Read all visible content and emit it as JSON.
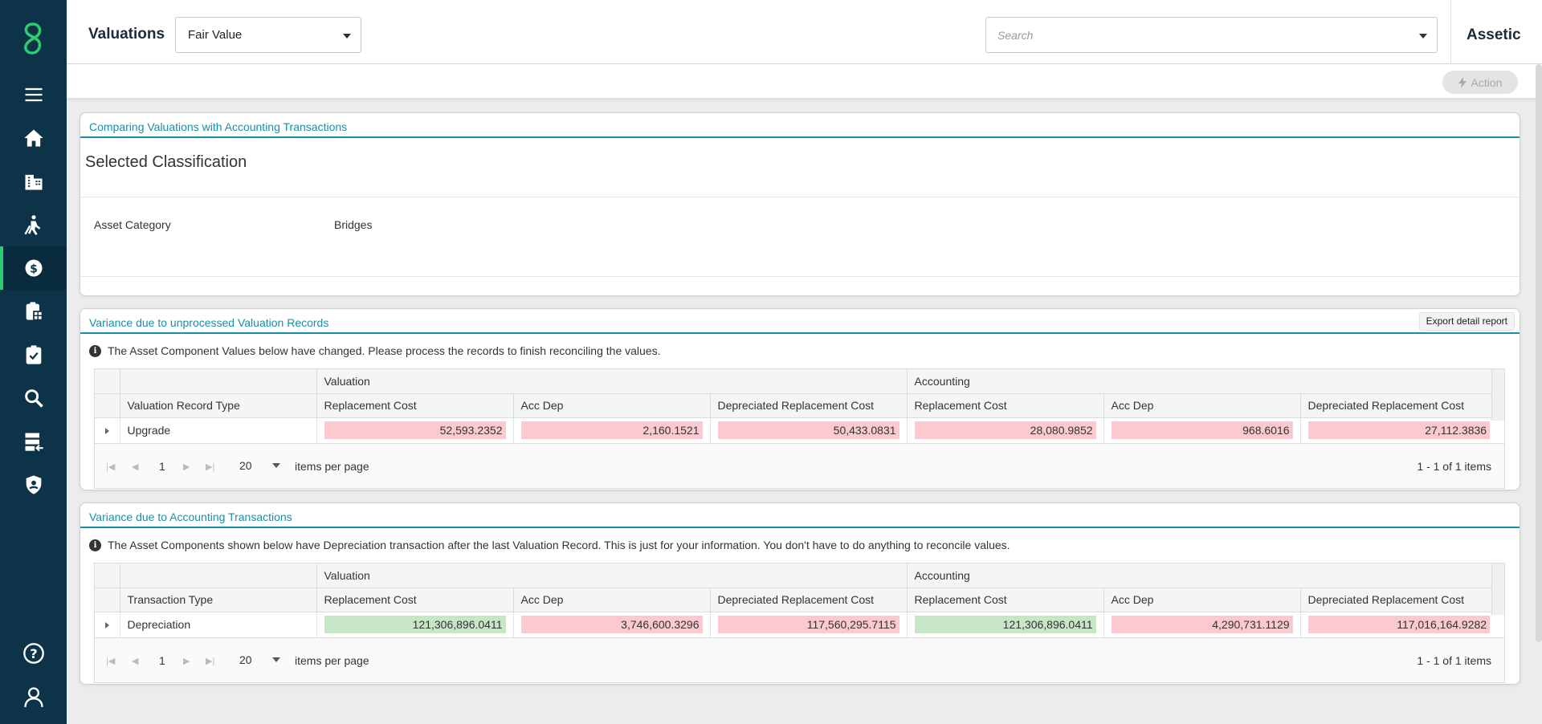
{
  "header": {
    "title": "Valuations",
    "fair_value": "Fair Value",
    "search_placeholder": "Search",
    "brand": "Assetic"
  },
  "subbar": {
    "action_label": "Action"
  },
  "sidebar": {
    "items": [
      {
        "icon": "menu-icon"
      },
      {
        "icon": "home-icon"
      },
      {
        "icon": "building-icon"
      },
      {
        "icon": "maintenance-worker-icon"
      },
      {
        "icon": "finance-icon",
        "active": true
      },
      {
        "icon": "clipboard-grid-icon"
      },
      {
        "icon": "checklist-icon"
      },
      {
        "icon": "search-icon"
      },
      {
        "icon": "data-import-icon"
      },
      {
        "icon": "security-shield-icon"
      },
      {
        "icon": "help-icon"
      },
      {
        "icon": "user-icon"
      }
    ]
  },
  "panel1": {
    "title": "Comparing Valuations with Accounting Transactions",
    "heading": "Selected Classification",
    "field_label": "Asset Category",
    "field_value": "Bridges"
  },
  "panel2": {
    "title": "Variance due to unprocessed Valuation Records",
    "export_label": "Export detail report",
    "info": "The Asset Component Values below have changed. Please process the records to finish reconciling the values.",
    "group_valuation": "Valuation",
    "group_accounting": "Accounting",
    "col_type": "Valuation Record Type",
    "cols": [
      "Replacement Cost",
      "Acc Dep",
      "Depreciated Replacement Cost",
      "Replacement Cost",
      "Acc Dep",
      "Depreciated Replacement Cost"
    ],
    "row": {
      "type": "Upgrade",
      "values": [
        "52,593.2352",
        "2,160.1521",
        "50,433.0831",
        "28,080.9852",
        "968.6016",
        "27,112.3836"
      ]
    },
    "pager": {
      "page": "1",
      "page_size": "20",
      "ipp_label": "items per page",
      "total": "1 - 1 of 1 items"
    }
  },
  "panel3": {
    "title": "Variance due to Accounting Transactions",
    "info": "The Asset Components shown below have Depreciation transaction after the last Valuation Record. This is just for your information. You don't have to do anything to reconcile values.",
    "group_valuation": "Valuation",
    "group_accounting": "Accounting",
    "col_type": "Transaction Type",
    "cols": [
      "Replacement Cost",
      "Acc Dep",
      "Depreciated Replacement Cost",
      "Replacement Cost",
      "Acc Dep",
      "Depreciated Replacement Cost"
    ],
    "row": {
      "type": "Depreciation",
      "values": [
        "121,306,896.0411",
        "3,746,600.3296",
        "117,560,295.7115",
        "121,306,896.0411",
        "4,290,731.1129",
        "117,016,164.9282"
      ]
    },
    "pager": {
      "page": "1",
      "page_size": "20",
      "ipp_label": "items per page",
      "total": "1 - 1 of 1 items"
    }
  },
  "colors": {
    "accent": "#1b8ea6",
    "sidebar": "#0d3349",
    "logo": "#2ecc71",
    "negative": "#fbc9cf",
    "positive": "#c6e6c6"
  }
}
